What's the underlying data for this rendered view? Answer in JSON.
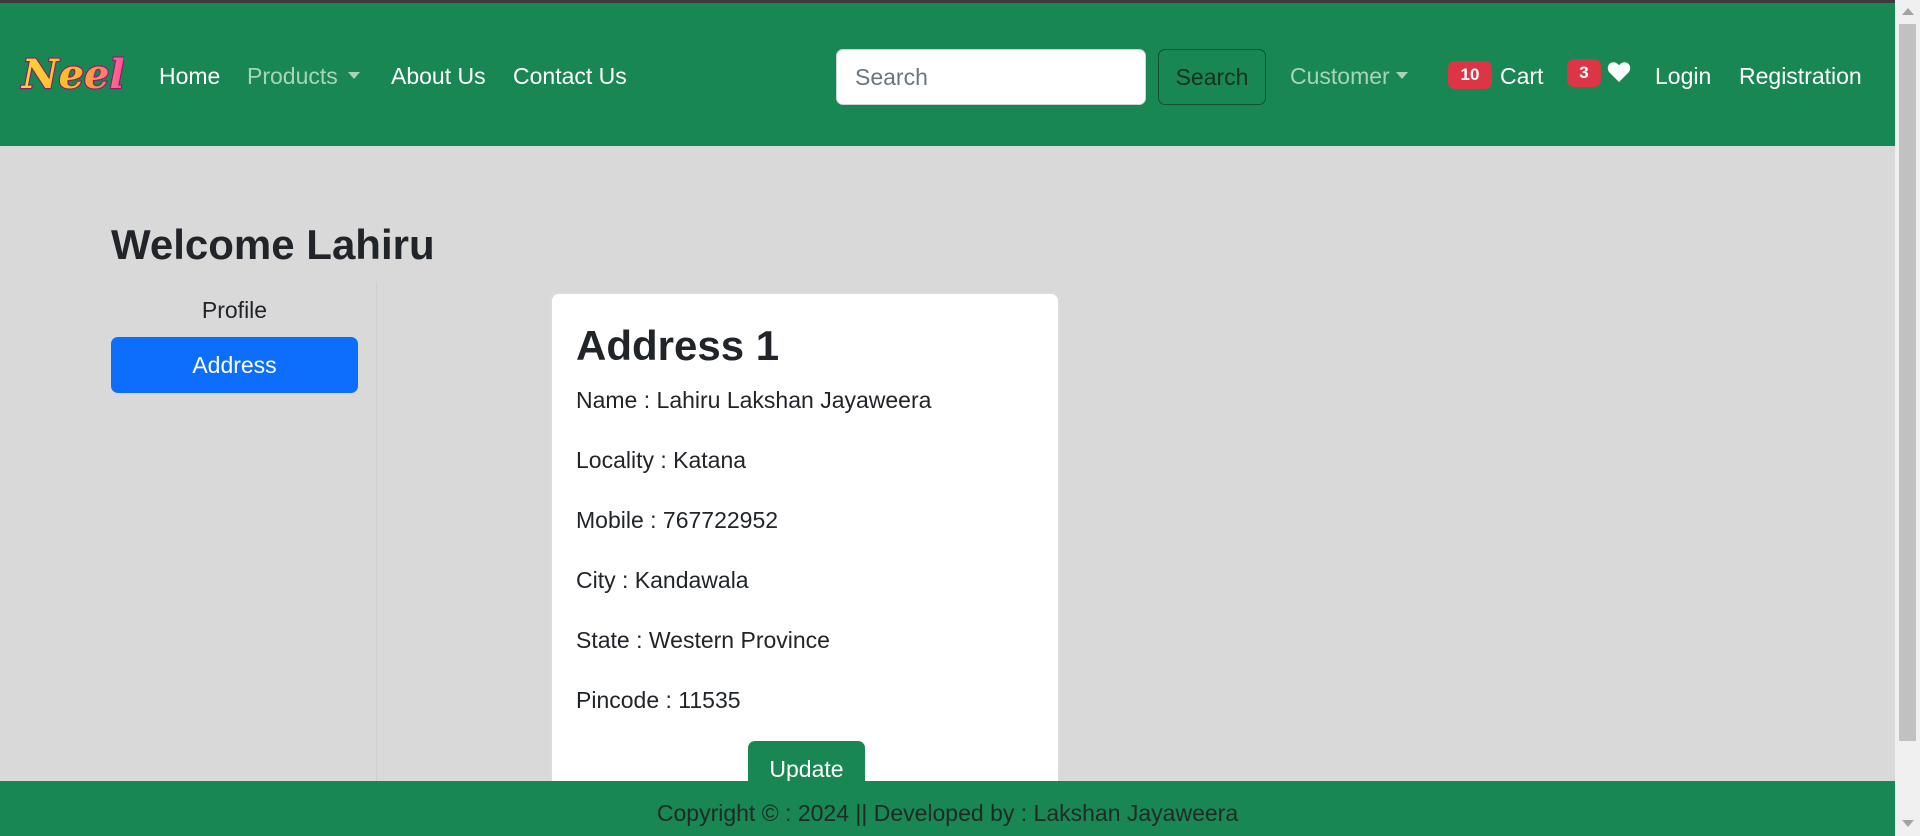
{
  "colors": {
    "nav_bg": "#198754",
    "primary": "#0d6efd",
    "badge": "#dc3545",
    "page_bg": "#d9d9d9"
  },
  "navbar": {
    "brand": "Neel",
    "links": {
      "home": "Home",
      "products": "Products",
      "about": "About Us",
      "contact": "Contact Us"
    },
    "search": {
      "placeholder": "Search",
      "button_label": "Search"
    },
    "customer": "Customer",
    "cart": {
      "count": "10",
      "label": "Cart"
    },
    "wishlist": {
      "count": "3",
      "icon": "heart-icon"
    },
    "login": "Login",
    "registration": "Registration"
  },
  "main": {
    "welcome": "Welcome Lahiru",
    "sidebar": {
      "items": [
        {
          "label": "Profile",
          "active": false
        },
        {
          "label": "Address",
          "active": true
        }
      ]
    },
    "address_card": {
      "title": "Address 1",
      "lines": [
        "Name : Lahiru Lakshan Jayaweera",
        "Locality : Katana",
        "Mobile : 767722952",
        "City : Kandawala",
        "State : Western Province",
        "Pincode : 11535"
      ],
      "button_label": "Update"
    }
  },
  "footer": {
    "text": "Copyright © : 2024 || Developed by : Lakshan Jayaweera"
  }
}
